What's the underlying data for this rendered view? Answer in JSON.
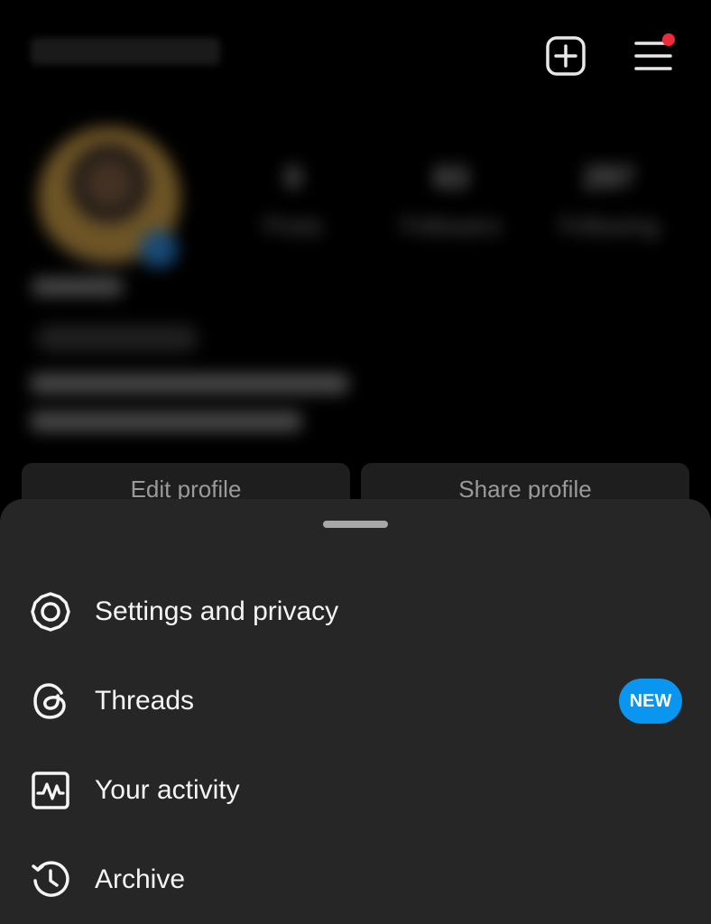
{
  "header": {
    "new_post_icon": "plus-square-icon",
    "menu_icon": "hamburger-menu-icon",
    "notification_color": "#ed2b3d"
  },
  "profile": {
    "stats": {
      "posts": {
        "value": "0",
        "label": "Posts"
      },
      "followers": {
        "value": "63",
        "label": "Followers"
      },
      "following": {
        "value": "297",
        "label": "Following"
      }
    },
    "edit_profile_label": "Edit profile",
    "share_profile_label": "Share profile"
  },
  "sheet": {
    "items": [
      {
        "label": "Settings and privacy",
        "icon": "gear-icon"
      },
      {
        "label": "Threads",
        "icon": "threads-icon",
        "badge": "NEW"
      },
      {
        "label": "Your activity",
        "icon": "activity-icon"
      },
      {
        "label": "Archive",
        "icon": "archive-clock-icon"
      }
    ],
    "badge_color": "#0a95f0"
  }
}
